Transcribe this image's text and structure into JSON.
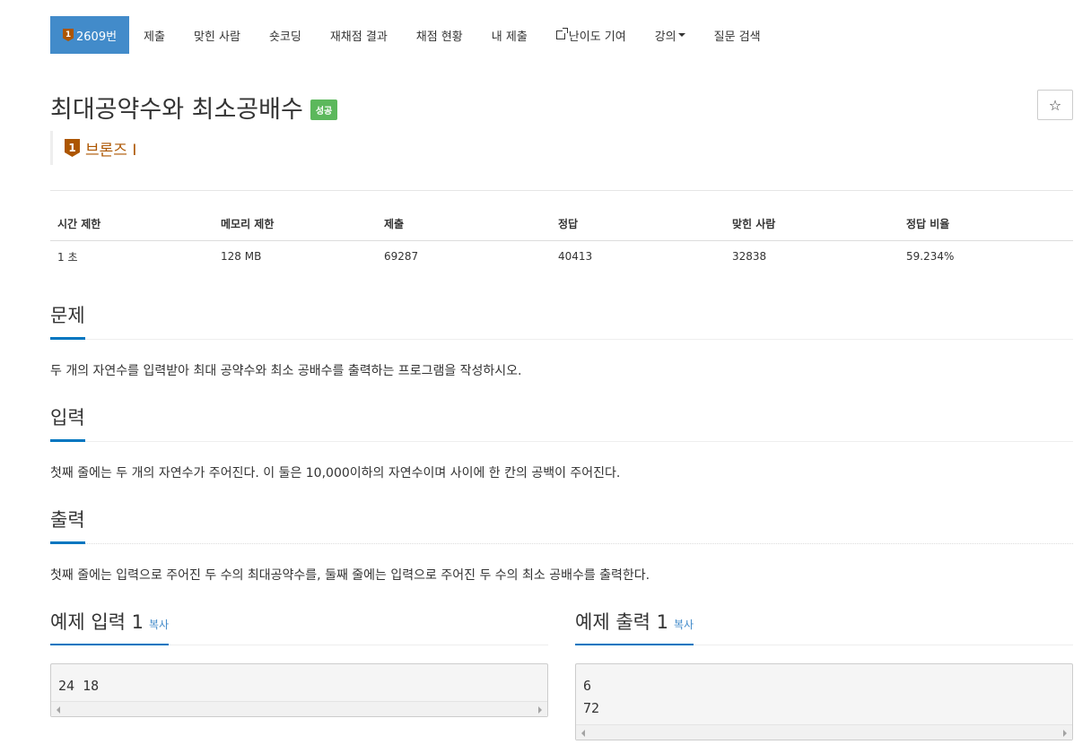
{
  "nav": {
    "problem_tier_icon": "1",
    "problem_number": "2609번",
    "tabs": [
      "제출",
      "맞힌 사람",
      "숏코딩",
      "재채점 결과",
      "채점 현황",
      "내 제출",
      "난이도 기여",
      "강의",
      "질문 검색"
    ]
  },
  "title": "최대공약수와 최소공배수",
  "result_badge": "성공",
  "star_icon": "☆",
  "tier": {
    "icon": "1",
    "label": "브론즈 I",
    "color": "#ad5600"
  },
  "info": {
    "headers": [
      "시간 제한",
      "메모리 제한",
      "제출",
      "정답",
      "맞힌 사람",
      "정답 비율"
    ],
    "values": [
      "1 초",
      "128 MB",
      "69287",
      "40413",
      "32838",
      "59.234%"
    ]
  },
  "sections": {
    "problem": {
      "title": "문제",
      "text": "두 개의 자연수를 입력받아 최대 공약수와 최소 공배수를 출력하는 프로그램을 작성하시오."
    },
    "input": {
      "title": "입력",
      "text": "첫째 줄에는 두 개의 자연수가 주어진다. 이 둘은 10,000이하의 자연수이며 사이에 한 칸의 공백이 주어진다."
    },
    "output": {
      "title": "출력",
      "text": "첫째 줄에는 입력으로 주어진 두 수의 최대공약수를, 둘째 줄에는 입력으로 주어진 두 수의 최소 공배수를 출력한다."
    }
  },
  "samples": {
    "input": {
      "title": "예제 입력 1",
      "copy": "복사",
      "lines": [
        "24 18"
      ]
    },
    "output": {
      "title": "예제 출력 1",
      "copy": "복사",
      "lines": [
        "6",
        "72"
      ]
    }
  },
  "colors": {
    "active_tab": "#428bca",
    "success": "#5cb85c",
    "bronze": "#ad5600",
    "accent": "#0076c0"
  }
}
